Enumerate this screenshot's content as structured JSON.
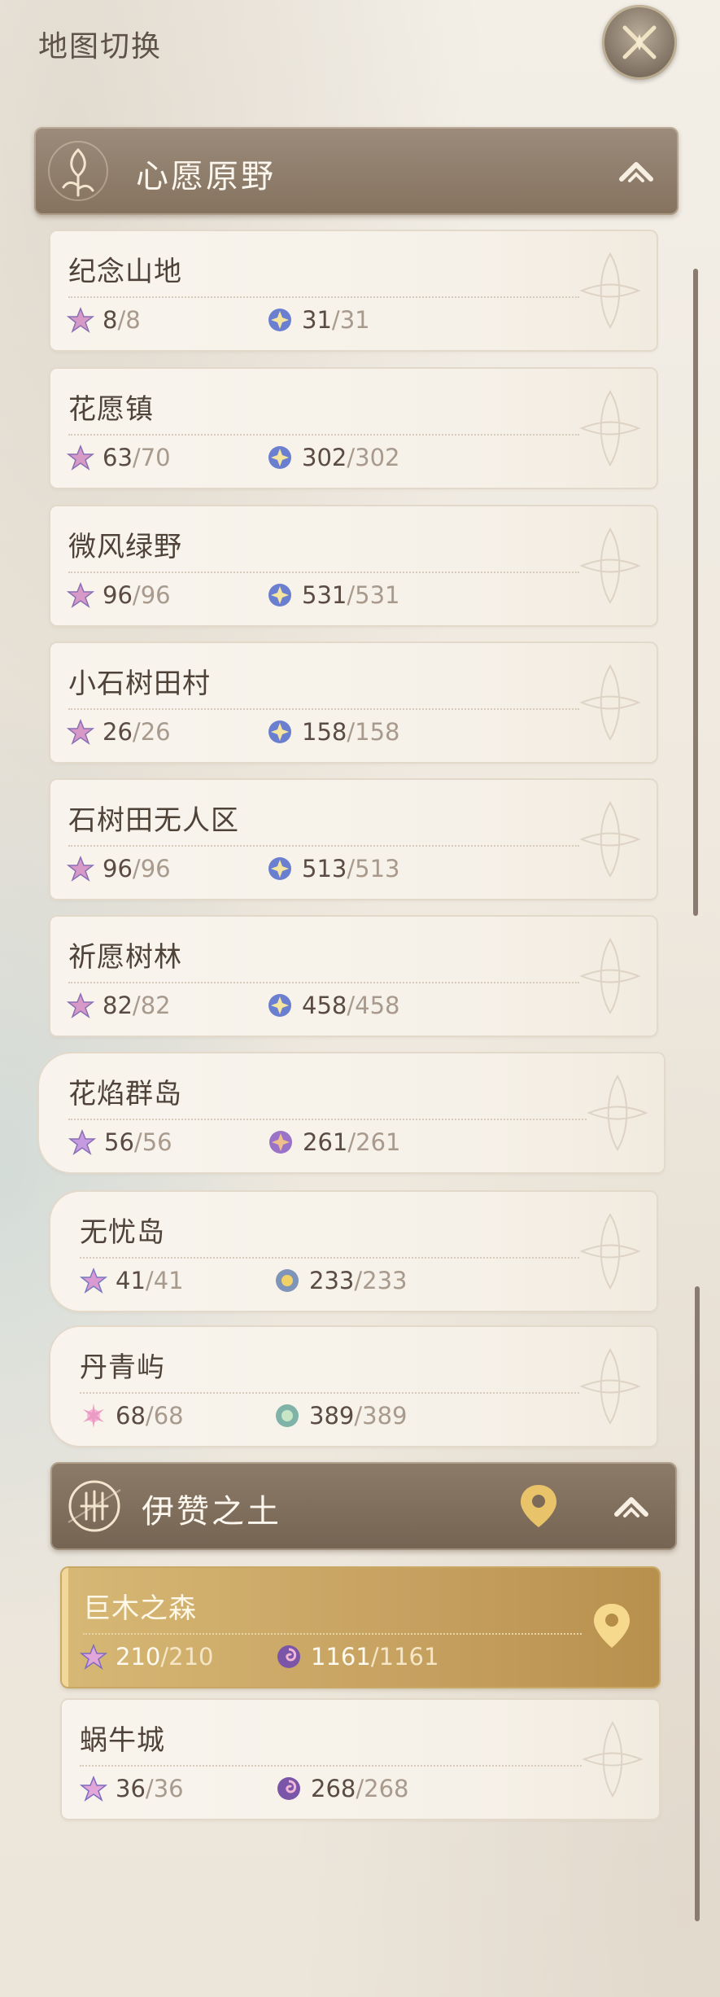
{
  "page_title": "地图切换",
  "sections": [
    {
      "title": "心愿原野",
      "cards": [
        {
          "name": "纪念山地",
          "a": [
            "8",
            "8"
          ],
          "b": [
            "31",
            "31"
          ]
        },
        {
          "name": "花愿镇",
          "a": [
            "63",
            "70"
          ],
          "b": [
            "302",
            "302"
          ]
        },
        {
          "name": "微风绿野",
          "a": [
            "96",
            "96"
          ],
          "b": [
            "531",
            "531"
          ]
        },
        {
          "name": "小石树田村",
          "a": [
            "26",
            "26"
          ],
          "b": [
            "158",
            "158"
          ]
        },
        {
          "name": "石树田无人区",
          "a": [
            "96",
            "96"
          ],
          "b": [
            "513",
            "513"
          ]
        },
        {
          "name": "祈愿树林",
          "a": [
            "82",
            "82"
          ],
          "b": [
            "458",
            "458"
          ]
        },
        {
          "name": "花焰群岛",
          "a": [
            "56",
            "56"
          ],
          "b": [
            "261",
            "261"
          ]
        },
        {
          "name": "无忧岛",
          "a": [
            "41",
            "41"
          ],
          "b": [
            "233",
            "233"
          ]
        },
        {
          "name": "丹青屿",
          "a": [
            "68",
            "68"
          ],
          "b": [
            "389",
            "389"
          ]
        }
      ]
    },
    {
      "title": "伊赞之土",
      "cards": [
        {
          "name": "巨木之森",
          "a": [
            "210",
            "210"
          ],
          "b": [
            "1161",
            "1161"
          ],
          "selected": true
        },
        {
          "name": "蜗牛城",
          "a": [
            "36",
            "36"
          ],
          "b": [
            "268",
            "268"
          ]
        }
      ]
    }
  ],
  "icons": {
    "close": "close-x-icon",
    "collapse": "chevron-up-icon",
    "location": "location-pin-icon",
    "stat_a": "star-collectible-icon",
    "stat_b": "orb-collectible-icon"
  },
  "colors": {
    "header_bg": "#8f7d6a",
    "selected_card": "#c7a261",
    "pin": "#e9c36a"
  }
}
